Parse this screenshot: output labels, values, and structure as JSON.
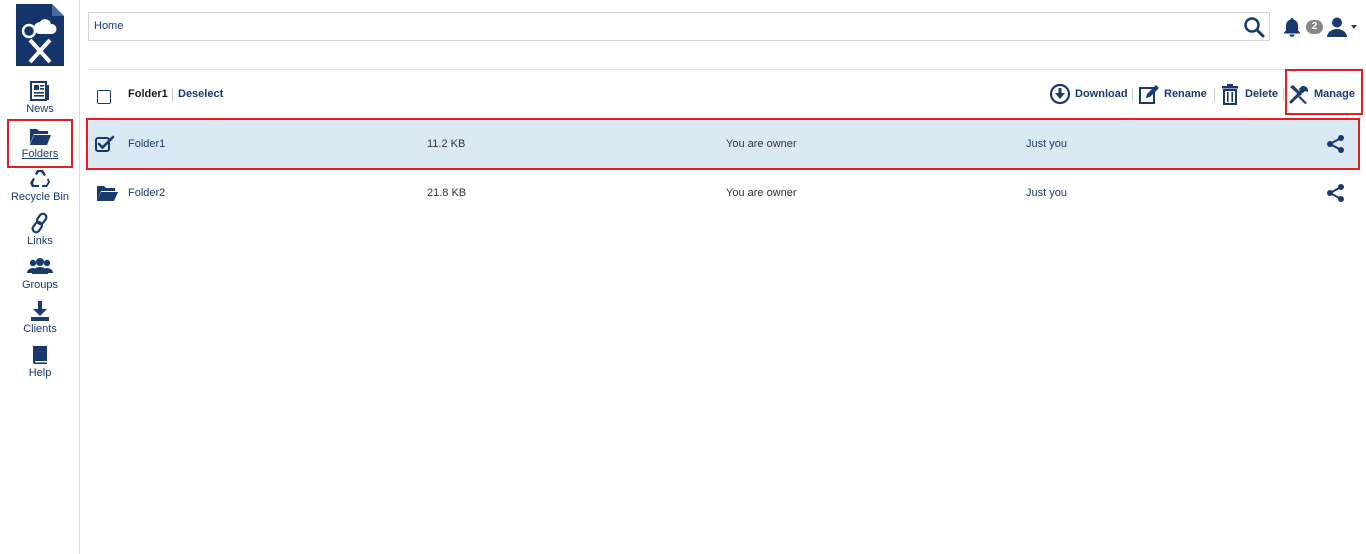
{
  "sidebar": {
    "items": [
      {
        "label": "News",
        "icon": "newspaper-icon"
      },
      {
        "label": "Folders",
        "icon": "folder-open-icon",
        "active": true
      },
      {
        "label": "Recycle Bin",
        "icon": "recycle-icon"
      },
      {
        "label": "Links",
        "icon": "link-icon"
      },
      {
        "label": "Groups",
        "icon": "users-icon"
      },
      {
        "label": "Clients",
        "icon": "download-icon"
      },
      {
        "label": "Help",
        "icon": "book-icon"
      }
    ]
  },
  "topbar": {
    "breadcrumb": "Home",
    "notification_count": "2"
  },
  "toolbar": {
    "selected_name": "Folder1",
    "deselect_label": "Deselect",
    "actions": {
      "download": "Download",
      "rename": "Rename",
      "delete": "Delete",
      "manage": "Manage"
    }
  },
  "files": [
    {
      "name": "Folder1",
      "size": "11.2 KB",
      "owner": "You are owner",
      "shared_with": "Just you",
      "selected": true
    },
    {
      "name": "Folder2",
      "size": "21.8 KB",
      "owner": "You are owner",
      "shared_with": "Just you",
      "selected": false
    }
  ],
  "colors": {
    "accent": "#1a3a6e",
    "selected_row": "#daeaf5",
    "highlight": "#e02020"
  }
}
